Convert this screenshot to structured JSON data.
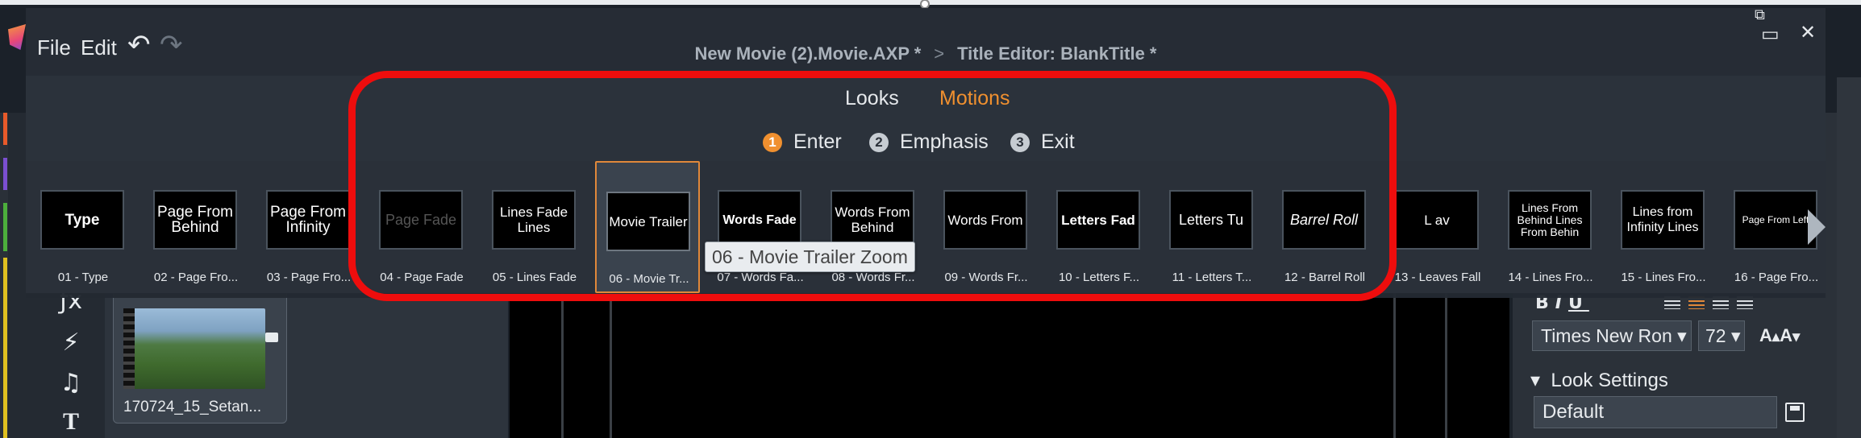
{
  "window": {
    "breadcrumb": "New Movie (2).Movie.AXP *",
    "separator": ">",
    "editor_title": "Title Editor: BlankTitle *"
  },
  "menu": {
    "file": "File",
    "edit": "Edit"
  },
  "tabs": {
    "looks": "Looks",
    "motions": "Motions",
    "active": "Motions"
  },
  "steps": [
    {
      "num": "1",
      "label": "Enter",
      "active": true
    },
    {
      "num": "2",
      "label": "Emphasis",
      "active": false
    },
    {
      "num": "3",
      "label": "Exit",
      "active": false
    }
  ],
  "motions": [
    {
      "preview": "Type",
      "label": "01 - Type"
    },
    {
      "preview": "Page From\nBehind",
      "label": "02 - Page Fro..."
    },
    {
      "preview": "Page From\nInfinity",
      "label": "03 - Page Fro..."
    },
    {
      "preview": "Page Fade",
      "label": "04 - Page Fade"
    },
    {
      "preview": "Lines Fade\nLines",
      "label": "05 - Lines Fade"
    },
    {
      "preview": "Movie Trailer",
      "label": "06 - Movie Tr...",
      "selected": true
    },
    {
      "preview": "Words Fade",
      "label": "07 - Words Fa..."
    },
    {
      "preview": "Words From\nBehind",
      "label": "08 - Words Fr..."
    },
    {
      "preview": "Words From",
      "label": "09 - Words Fr..."
    },
    {
      "preview": "Letters Fad",
      "label": "10 - Letters F..."
    },
    {
      "preview": "Letters Tu",
      "label": "11 - Letters T..."
    },
    {
      "preview": "Barrel Roll",
      "label": "12 - Barrel Roll"
    },
    {
      "preview": "L av",
      "label": "13 - Leaves Fall"
    },
    {
      "preview": "Lines From\nBehind Lines\nFrom Behin",
      "label": "14 - Lines Fro..."
    },
    {
      "preview": "Lines from\nInfinity Lines",
      "label": "15 - Lines Fro..."
    },
    {
      "preview": "Page From Left",
      "label": "16 - Page Fro..."
    }
  ],
  "tooltip": "06 - Movie Trailer Zoom",
  "library": {
    "clip_label": "170724_15_Setan..."
  },
  "text_settings": {
    "font": "Times New Ron",
    "size": "72",
    "look_settings_label": "Look Settings",
    "look_value": "Default"
  },
  "colors": {
    "accent": "#e0883a",
    "highlight": "#ee0d0d"
  }
}
